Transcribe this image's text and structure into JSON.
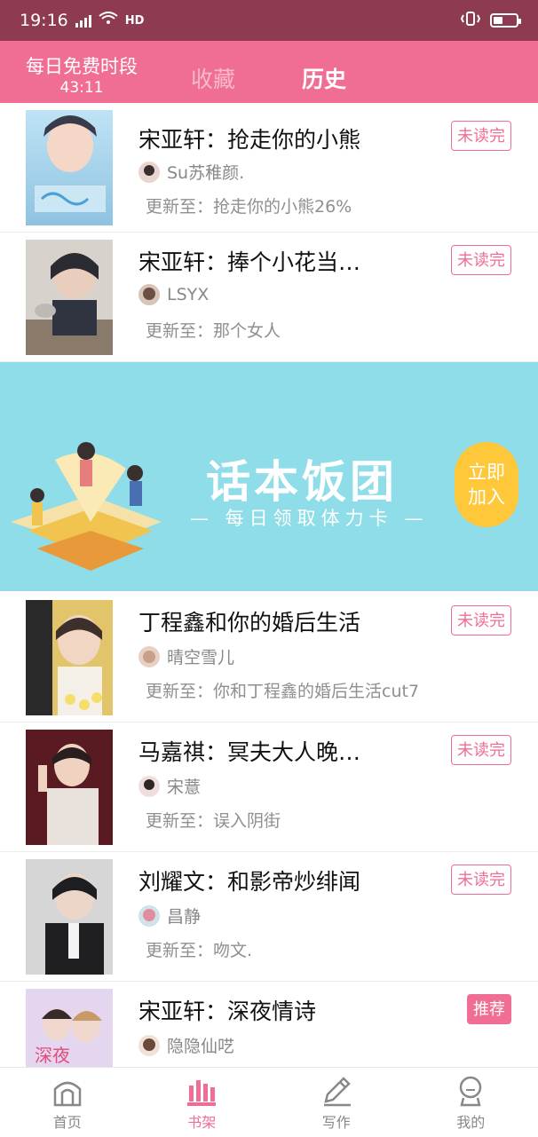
{
  "status": {
    "time": "19:16",
    "net_badge": "4G",
    "hd": "HD"
  },
  "header": {
    "free_label": "每日免费时段",
    "free_time": "43:11",
    "tabs": [
      {
        "label": "收藏"
      },
      {
        "label": "历史"
      }
    ],
    "active_tab": "历史"
  },
  "books": [
    {
      "title": "宋亚轩：抢走你的小熊",
      "author": "Su苏稚颜.",
      "update": "更新至：抢走你的小熊26%",
      "badge": "未读完"
    },
    {
      "title": "宋亚轩：捧个小花当…",
      "author": "LSYX",
      "update": "更新至：那个女人",
      "badge": "未读完"
    },
    {
      "title": "丁程鑫和你的婚后生活",
      "author": "晴空雪儿",
      "update": "更新至：你和丁程鑫的婚后生活cut7",
      "badge": "未读完"
    },
    {
      "title": "马嘉祺：冥夫大人晚…",
      "author": "宋薏",
      "update": "更新至：误入阴街",
      "badge": "未读完"
    },
    {
      "title": "刘耀文：和影帝炒绯闻",
      "author": "昌静",
      "update": "更新至：吻文.",
      "badge": "未读完"
    },
    {
      "title": "宋亚轩：深夜情诗",
      "author": "隐隐仙呓",
      "update": "",
      "badge": "推荐"
    }
  ],
  "banner": {
    "title": "话本饭团",
    "subtitle": "— 每日领取体力卡 —",
    "button_line1": "立即",
    "button_line2": "加入"
  },
  "bottom_nav": [
    {
      "label": "首页",
      "icon": "home-icon"
    },
    {
      "label": "书架",
      "icon": "bookshelf-icon"
    },
    {
      "label": "写作",
      "icon": "pencil-icon"
    },
    {
      "label": "我的",
      "icon": "profile-icon"
    }
  ],
  "colors": {
    "accent": "#f06e93",
    "statusbar": "#8e3b52",
    "banner_bg": "#8fdde8",
    "join_button": "#ffc83a"
  }
}
